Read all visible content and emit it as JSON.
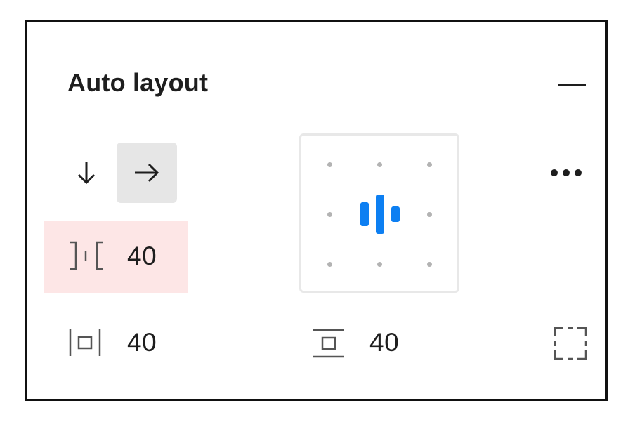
{
  "panel": {
    "title": "Auto layout",
    "collapse_icon": "minus-icon",
    "direction": {
      "options": [
        {
          "name": "vertical",
          "icon": "arrow-down-icon",
          "selected": false
        },
        {
          "name": "horizontal",
          "icon": "arrow-right-icon",
          "selected": true
        }
      ]
    },
    "gap": {
      "icon": "gap-between-icon",
      "value": "40",
      "highlight_color": "#fde6e6"
    },
    "horizontal_padding": {
      "icon": "horizontal-padding-icon",
      "value": "40"
    },
    "vertical_padding": {
      "icon": "vertical-padding-icon",
      "value": "40"
    },
    "alignment": {
      "icon": "align-center-bars-icon",
      "selected_position": "center",
      "accent_color": "#0d7ff2",
      "dot_color": "#b3b3b3"
    },
    "more_icon": "more-horizontal-icon",
    "clip_icon": "clip-content-icon"
  }
}
